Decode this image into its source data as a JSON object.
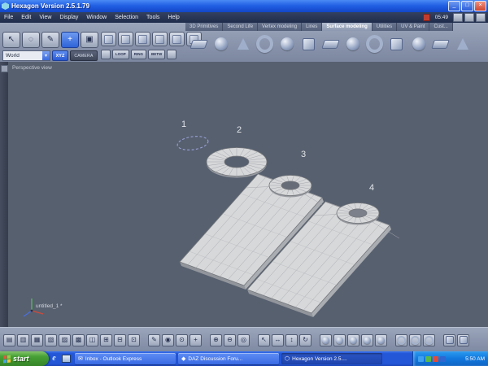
{
  "window": {
    "title": "Hexagon Version 2.5.1.79",
    "menu_time": "05:49"
  },
  "menu": {
    "items": [
      "File",
      "Edit",
      "View",
      "Display",
      "Window",
      "Selection",
      "Tools",
      "Help"
    ]
  },
  "tabs": {
    "items": [
      {
        "name": "tab-3d-primitives",
        "label": "3D Primitives"
      },
      {
        "name": "tab-second-life",
        "label": "Second Life"
      },
      {
        "name": "tab-vertex-modeling",
        "label": "Vertex modeling"
      },
      {
        "name": "tab-lines",
        "label": "Lines"
      },
      {
        "name": "tab-surface-modeling",
        "label": "Surface modeling",
        "active": true
      },
      {
        "name": "tab-utilities",
        "label": "Utilities"
      },
      {
        "name": "tab-uv-paint",
        "label": "UV & Paint"
      },
      {
        "name": "tab-cust",
        "label": "Cust..."
      }
    ]
  },
  "tools": {
    "world_selector_value": "World",
    "xyz_label": "XYZ",
    "camera_label": "CAMERA",
    "loop_label": "LOOP",
    "ring_label": "RING",
    "betw_label": "BETW",
    "select_tools": [
      {
        "name": "select-arrow-icon",
        "glyph": "↖"
      },
      {
        "name": "lasso-select-icon",
        "glyph": "◌"
      },
      {
        "name": "pen-tool-icon",
        "glyph": "✎"
      },
      {
        "name": "manipulator-tool-icon",
        "glyph": "+",
        "active": true
      },
      {
        "name": "camera-tool-icon",
        "glyph": "▣"
      }
    ],
    "edge_tools": [
      {
        "name": "tessellate-icon",
        "shape": "cube"
      },
      {
        "name": "edge-loop-icon",
        "shape": "cube"
      },
      {
        "name": "edge-ring-icon",
        "shape": "cube"
      },
      {
        "name": "connect-icon",
        "shape": "cube"
      },
      {
        "name": "dissolve-icon",
        "shape": "cube"
      },
      {
        "name": "weld-icon",
        "shape": "cube"
      }
    ],
    "surface_tools": [
      {
        "name": "thickness-icon",
        "shape": "slab"
      },
      {
        "name": "smoothing-icon",
        "shape": "sphere"
      },
      {
        "name": "extrude-surface-icon",
        "shape": "cone"
      },
      {
        "name": "sweep-surface-icon",
        "shape": "ring"
      },
      {
        "name": "coons-surface-icon",
        "shape": "sphere"
      },
      {
        "name": "gordon-surface-icon",
        "shape": "cube"
      },
      {
        "name": "double-sweep-icon",
        "shape": "slab"
      },
      {
        "name": "ruled-surface-icon",
        "shape": "sphere"
      },
      {
        "name": "revolution-icon",
        "shape": "ring"
      },
      {
        "name": "offset-surface-icon",
        "shape": "cube"
      },
      {
        "name": "crown-icon",
        "shape": "sphere"
      },
      {
        "name": "fillet-icon",
        "shape": "slab"
      },
      {
        "name": "bridge-icon",
        "shape": "cone"
      }
    ]
  },
  "viewport": {
    "view_label": "Perspective view",
    "document_label": "untitled_1 *",
    "step_labels": [
      "1",
      "2",
      "3",
      "4"
    ]
  },
  "bottombar": {
    "layout_tools": [
      {
        "name": "viewport-single-icon",
        "glyph": "▤"
      },
      {
        "name": "viewport-split-h-icon",
        "glyph": "▥"
      },
      {
        "name": "viewport-split-v-icon",
        "glyph": "▦"
      },
      {
        "name": "viewport-quad-icon",
        "glyph": "▧"
      },
      {
        "name": "viewport-layout5-icon",
        "glyph": "▨"
      },
      {
        "name": "viewport-layout6-icon",
        "glyph": "▩"
      },
      {
        "name": "viewport-dual-icon",
        "glyph": "◫"
      },
      {
        "name": "grid-toggle-icon",
        "glyph": "⊞"
      },
      {
        "name": "grid-minus-icon",
        "glyph": "⊟"
      },
      {
        "name": "grid-dot-icon",
        "glyph": "⊡"
      }
    ],
    "paint_tools": [
      {
        "name": "draw-icon",
        "glyph": "✎"
      },
      {
        "name": "snap-center-icon",
        "glyph": "◉"
      },
      {
        "name": "magnet-icon",
        "glyph": "⊙"
      },
      {
        "name": "add-icon",
        "glyph": "+"
      }
    ],
    "zoom_tools": [
      {
        "name": "zoom-in-icon",
        "glyph": "⊕"
      },
      {
        "name": "zoom-out-icon",
        "glyph": "⊖"
      },
      {
        "name": "zoom-fit-icon",
        "glyph": "◎"
      }
    ],
    "nav_tools": [
      {
        "name": "select-mode-icon",
        "glyph": "↖"
      },
      {
        "name": "pan-h-icon",
        "glyph": "↔"
      },
      {
        "name": "pan-v-icon",
        "glyph": "↕"
      },
      {
        "name": "rotate-view-icon",
        "glyph": "↻"
      }
    ],
    "shading_tools": [
      {
        "name": "shading-wireframe-icon",
        "shape": "sphere"
      },
      {
        "name": "shading-flat-icon",
        "shape": "sphere"
      },
      {
        "name": "shading-smooth-icon",
        "shape": "sphere"
      },
      {
        "name": "shading-textured-icon",
        "shape": "sphere"
      },
      {
        "name": "shading-transparent-icon",
        "shape": "sphere"
      }
    ],
    "render_tools": [
      {
        "name": "render-mode-icon",
        "shape": "ring"
      },
      {
        "name": "material-ball-icon",
        "shape": "ring"
      },
      {
        "name": "light-toggle-icon",
        "shape": "ring"
      }
    ],
    "panel_tools": [
      {
        "name": "properties-panel-icon",
        "shape": "cube"
      },
      {
        "name": "scene-tree-icon",
        "shape": "cube"
      }
    ]
  },
  "taskbar": {
    "start_label": "start",
    "tasks": [
      {
        "name": "task-outlook-express",
        "label": "Inbox - Outlook Express",
        "icon": "✉"
      },
      {
        "name": "task-daz-forum",
        "label": "DAZ Discussion Foru...",
        "icon": "◆"
      },
      {
        "name": "task-hexagon",
        "label": "Hexagon Version 2.5....",
        "icon": "⬡",
        "active": true
      }
    ],
    "tray_icons": [
      {
        "name": "tray-network-icon",
        "color": "#3f9ff0"
      },
      {
        "name": "tray-shield-icon",
        "color": "#58b84d"
      },
      {
        "name": "tray-alert-icon",
        "color": "#e04a3a"
      },
      {
        "name": "tray-volume-icon",
        "color": "#2f66d0"
      }
    ],
    "clock": "5:50 AM"
  }
}
